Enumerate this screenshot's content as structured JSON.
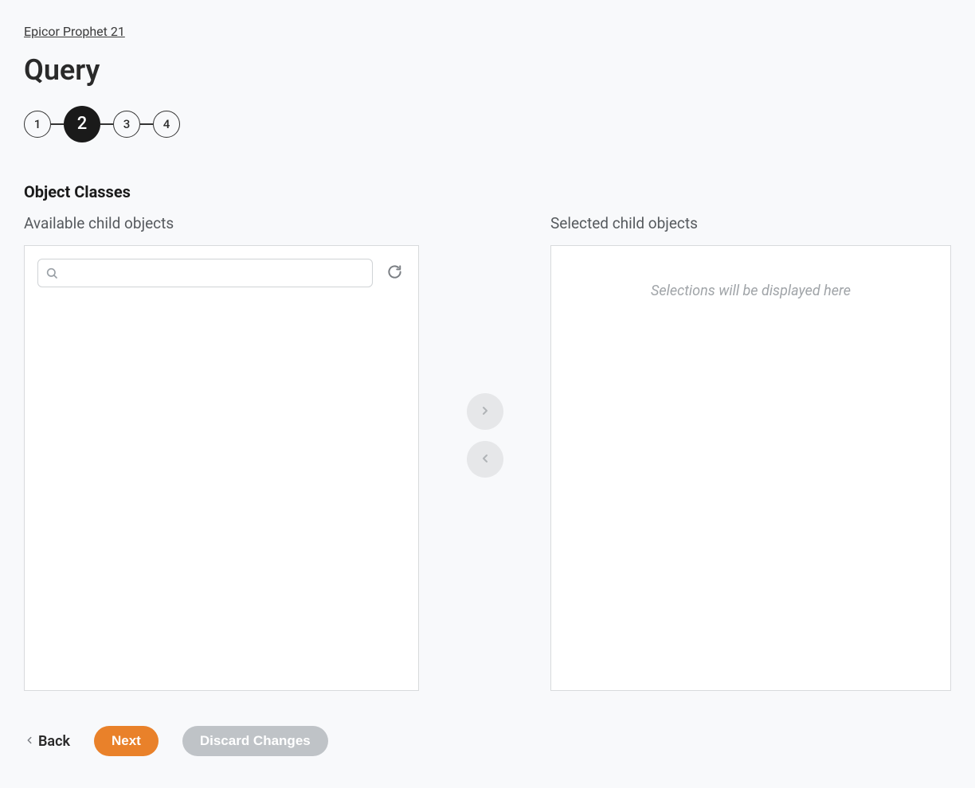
{
  "breadcrumb": "Epicor Prophet 21",
  "page_title": "Query",
  "stepper": {
    "steps": [
      "1",
      "2",
      "3",
      "4"
    ],
    "active_index": 1
  },
  "section": {
    "title": "Object Classes",
    "available_label": "Available child objects",
    "selected_label": "Selected child objects",
    "search_placeholder": "",
    "empty_message": "Selections will be displayed here"
  },
  "actions": {
    "back": "Back",
    "next": "Next",
    "discard": "Discard Changes"
  }
}
